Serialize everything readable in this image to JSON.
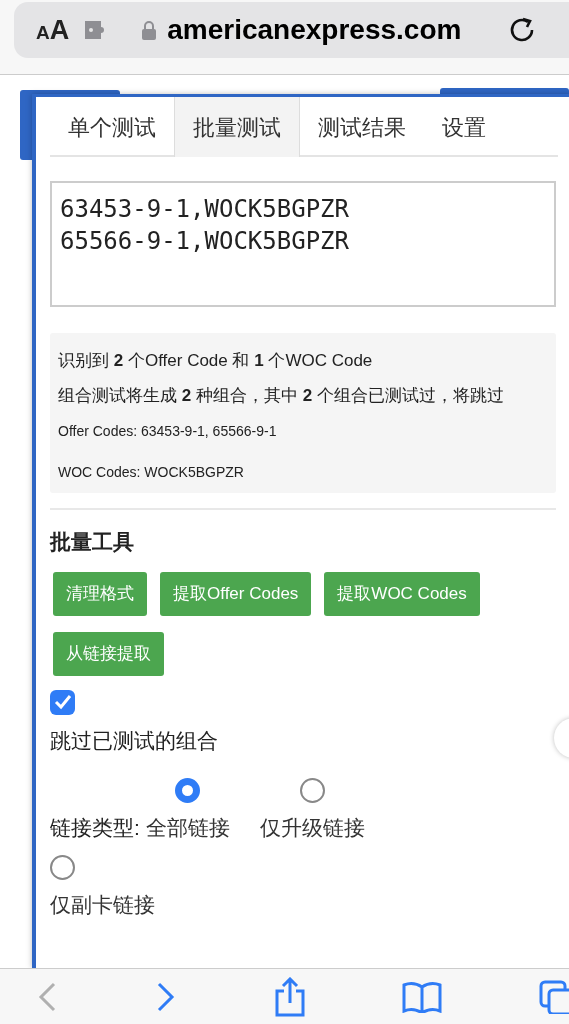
{
  "browser": {
    "text_size_button": "AA",
    "url": "americanexpress.com"
  },
  "tabs": [
    {
      "label": "单个测试",
      "selected": false
    },
    {
      "label": "批量测试",
      "selected": true
    },
    {
      "label": "测试结果",
      "selected": false
    },
    {
      "label": "设置",
      "selected": false
    }
  ],
  "codes_input": {
    "value": "63453-9-1,WOCK5BGPZR\n65566-9-1,WOCK5BGPZR"
  },
  "summary": {
    "lines": [
      "识别到 **2** 个Offer Code 和 **1** 个WOC Code",
      "组合测试将生成 **2** 种组合，其中 **2** 个组合已测试过，将跳过"
    ],
    "details": [
      "Offer Codes: 63453-9-1, 65566-9-1",
      "WOC Codes: WOCK5BGPZR"
    ]
  },
  "batch_tools": {
    "title": "批量工具",
    "buttons": [
      "清理格式",
      "提取Offer Codes",
      "提取WOC Codes",
      "从链接提取"
    ]
  },
  "skip_tested": {
    "label": "跳过已测试的组合",
    "checked": true
  },
  "link_type": {
    "label": "链接类型:",
    "options": [
      {
        "label": "全部链接",
        "selected": true
      },
      {
        "label": "仅升级链接",
        "selected": false
      },
      {
        "label": "仅副卡链接",
        "selected": false
      }
    ]
  },
  "toolbar": [
    {
      "kind": "back",
      "disabled": true
    },
    {
      "kind": "forward",
      "disabled": false
    },
    {
      "kind": "share",
      "disabled": false
    },
    {
      "kind": "bookmarks",
      "disabled": false
    },
    {
      "kind": "tabs",
      "disabled": false
    }
  ]
}
